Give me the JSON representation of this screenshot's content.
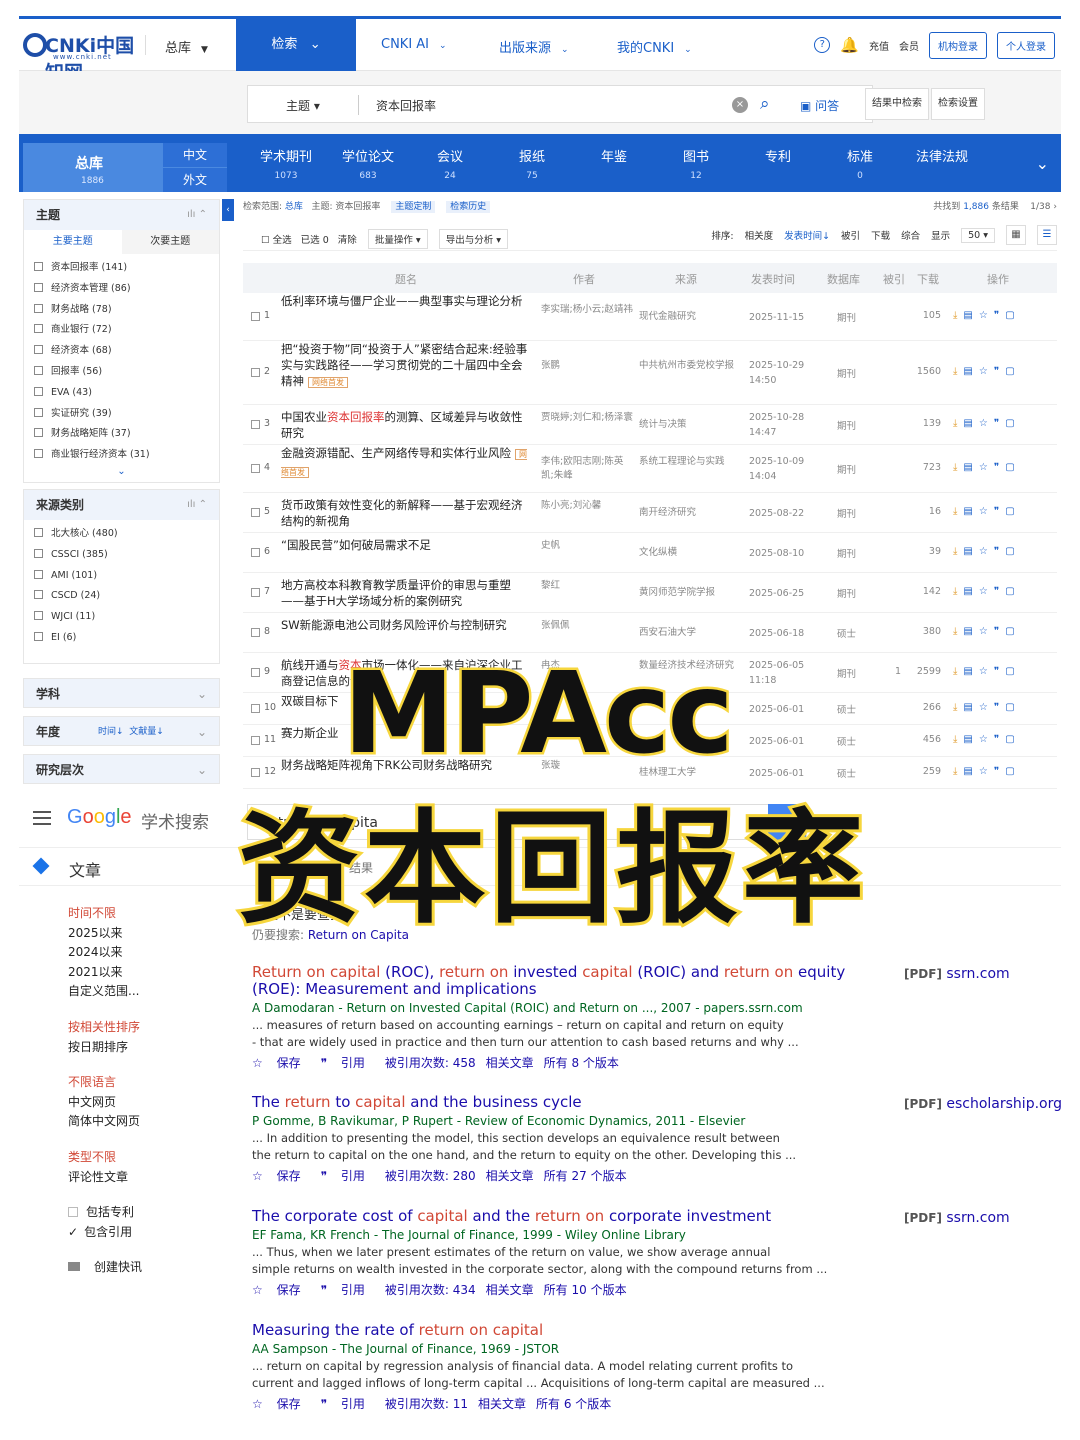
{
  "cnki": {
    "logo_text": "CNKi中国知网",
    "logo_url": "www.cnki.net",
    "nav": {
      "all": "总库",
      "search": "检索",
      "ai": "CNKI AI",
      "source": "出版来源",
      "my": "我的CNKI"
    },
    "top_right": {
      "recharge": "充值",
      "member": "会员",
      "org_login": "机构登录",
      "personal_login": "个人登录"
    },
    "search": {
      "field": "主题",
      "query": "资本回报率",
      "ask": "问答",
      "in_results": "结果中检索",
      "settings": "检索设置"
    },
    "db_all": {
      "label": "总库",
      "count": "1886",
      "zh": "中文",
      "foreign": "外文"
    },
    "databases": [
      {
        "label": "学术期刊",
        "count": "1073"
      },
      {
        "label": "学位论文",
        "count": "683"
      },
      {
        "label": "会议",
        "count": "24"
      },
      {
        "label": "报纸",
        "count": "75"
      },
      {
        "label": "年鉴",
        "count": ""
      },
      {
        "label": "图书",
        "count": "12"
      },
      {
        "label": "专利",
        "count": ""
      },
      {
        "label": "标准",
        "count": "0"
      },
      {
        "label": "法律法规",
        "count": ""
      }
    ],
    "sidebar": {
      "topic": {
        "title": "主题",
        "tab_main": "主要主题",
        "tab_sub": "次要主题",
        "items": [
          "资本回报率 (141)",
          "经济资本管理 (86)",
          "财务战略 (78)",
          "商业银行 (72)",
          "经济资本 (68)",
          "回报率 (56)",
          "EVA (43)",
          "实证研究 (39)",
          "财务战略矩阵 (37)",
          "商业银行经济资本 (31)"
        ]
      },
      "source": {
        "title": "来源类别",
        "items": [
          "北大核心 (480)",
          "CSSCI (385)",
          "AMI (101)",
          "CSCD (24)",
          "WJCI (11)",
          "EI (6)"
        ]
      },
      "subject": "学科",
      "year": {
        "title": "年度",
        "sort_time": "时间↓",
        "sort_count": "文献量↓"
      },
      "level": "研究层次"
    },
    "crumb": {
      "scope": "检索范围:",
      "scope_val": "总库",
      "topic": "主题: 资本回报率",
      "custom": "主题定制",
      "history": "检索历史",
      "found": "共找到",
      "found_num": "1,886",
      "found_suffix": "条结果",
      "page": "1/38"
    },
    "toolbar": {
      "select_all": "全选",
      "selected": "已选",
      "selected_num": "0",
      "clear": "清除",
      "batch": "批量操作",
      "export": "导出与分析",
      "sort_label": "排序:",
      "relevance": "相关度",
      "pub_time": "发表时间↓",
      "cited": "被引",
      "download": "下载",
      "overall": "综合",
      "show": "显示",
      "per_page": "50"
    },
    "headers": {
      "title": "题名",
      "author": "作者",
      "source": "来源",
      "date": "发表时间",
      "db": "数据库",
      "cited": "被引",
      "download": "下载",
      "ops": "操作"
    },
    "rows": [
      {
        "no": "1",
        "pre": "低利率环境与僵尸企业——典型事实与理论分析",
        "hl": "",
        "post": "",
        "badge": "",
        "author": "李实瑞;杨小云;赵靖祎",
        "source": "现代金融研究",
        "date": "2025-11-15",
        "db": "期刊",
        "cited": "",
        "dl": "105"
      },
      {
        "no": "2",
        "pre": "把“投资于物”同“投资于人”紧密结合起来:经验事实与实践路径——学习贯彻党的二十届四中全会精神",
        "hl": "",
        "post": "",
        "badge": "网络首发",
        "author": "张鹏",
        "source": "中共杭州市委党校学报",
        "date": "2025-10-29 14:50",
        "db": "期刊",
        "cited": "",
        "dl": "1560"
      },
      {
        "no": "3",
        "pre": "中国农业",
        "hl": "资本回报率",
        "post": "的测算、区域差异与收敛性研究",
        "badge": "",
        "author": "贾晓婷;刘仁和;杨泽寰",
        "source": "统计与决策",
        "date": "2025-10-28 14:47",
        "db": "期刊",
        "cited": "",
        "dl": "139"
      },
      {
        "no": "4",
        "pre": "金融资源错配、生产网络传导和实体行业风险",
        "hl": "",
        "post": "",
        "badge": "网络首发",
        "author": "李伟;欧阳志刚;陈英凯;朱峰",
        "source": "系统工程理论与实践",
        "date": "2025-10-09 14:04",
        "db": "期刊",
        "cited": "",
        "dl": "723"
      },
      {
        "no": "5",
        "pre": "货币政策有效性变化的新解释——基于宏观经济结构的新视角",
        "hl": "",
        "post": "",
        "badge": "",
        "author": "陈小亮;刘沁馨",
        "source": "南开经济研究",
        "date": "2025-08-22",
        "db": "期刊",
        "cited": "",
        "dl": "16"
      },
      {
        "no": "6",
        "pre": "“国股民营”如何破局需求不足",
        "hl": "",
        "post": "",
        "badge": "",
        "author": "史帆",
        "source": "文化纵横",
        "date": "2025-08-10",
        "db": "期刊",
        "cited": "",
        "dl": "39"
      },
      {
        "no": "7",
        "pre": "地方高校本科教育教学质量评价的审思与重塑——基于H大学场域分析的案例研究",
        "hl": "",
        "post": "",
        "badge": "",
        "author": "黎红",
        "source": "黄冈师范学院学报",
        "date": "2025-06-25",
        "db": "期刊",
        "cited": "",
        "dl": "142"
      },
      {
        "no": "8",
        "pre": "SW新能源电池公司财务风险评价与控制研究",
        "hl": "",
        "post": "",
        "badge": "",
        "author": "张佩佩",
        "source": "西安石油大学",
        "date": "2025-06-18",
        "db": "硕士",
        "cited": "",
        "dl": "380"
      },
      {
        "no": "9",
        "pre": "航线开通与",
        "hl": "资本",
        "post": "市场一体化——来自沪深企业工商登记信息的证据",
        "badge": "",
        "author": "冉杰",
        "source": "数量经济技术经济研究",
        "date": "2025-06-05 11:18",
        "db": "期刊",
        "cited": "1",
        "dl": "2599"
      },
      {
        "no": "10",
        "pre": "双碳目标下",
        "hl": "",
        "post": "",
        "badge": "",
        "author": "",
        "source": "",
        "date": "2025-06-01",
        "db": "硕士",
        "cited": "",
        "dl": "266"
      },
      {
        "no": "11",
        "pre": "赛力斯企业",
        "hl": "",
        "post": "",
        "badge": "",
        "author": "",
        "source": "",
        "date": "2025-06-01",
        "db": "硕士",
        "cited": "",
        "dl": "456"
      },
      {
        "no": "12",
        "pre": "财务战略矩阵视角下RK公司财务战略研究",
        "hl": "",
        "post": "",
        "badge": "",
        "author": "张璇",
        "source": "桂林理工大学",
        "date": "2025-06-01",
        "db": "硕士",
        "cited": "",
        "dl": "259"
      }
    ]
  },
  "google": {
    "logo": "Google",
    "product": "学术搜索",
    "query": "Return on Capita",
    "section": "文章",
    "found_text": "结果",
    "didyou_prefix": "您是不是要查找",
    "searched_label": "仍要搜索:",
    "searched_query": "Return on Capita",
    "side": {
      "time": [
        "时间不限",
        "2025以来",
        "2024以来",
        "2021以来",
        "自定义范围..."
      ],
      "sort": [
        "按相关性排序",
        "按日期排序"
      ],
      "lang": [
        "不限语言",
        "中文网页",
        "简体中文网页"
      ],
      "type": [
        "类型不限",
        "评论性文章"
      ],
      "include_patents": "包括专利",
      "include_citations": "包含引用",
      "alert": "创建快讯"
    },
    "actions": {
      "save": "保存",
      "cite": "引用",
      "related": "相关文章"
    },
    "results": [
      {
        "title_parts": [
          [
            "Return on capital",
            true
          ],
          [
            " (ROC), ",
            false
          ],
          [
            "return on",
            true
          ],
          [
            " invested ",
            false
          ],
          [
            "capital",
            true
          ],
          [
            " (ROIC) and ",
            false
          ],
          [
            "return on",
            true
          ],
          [
            " equity (ROE): Measurement and implications",
            false
          ]
        ],
        "meta": "A Damodaran - Return on Invested Capital (ROIC) and Return on ..., 2007 - papers.ssrn.com",
        "snip1": "... measures of return based on accounting earnings – return on capital and return on equity",
        "snip2": "- that are widely used in practice and then turn our attention to cash based returns and why ...",
        "cited": "被引用次数: 458",
        "versions": "所有 8 个版本",
        "pdf_tag": "[PDF]",
        "pdf_host": "ssrn.com"
      },
      {
        "title_parts": [
          [
            "The ",
            false
          ],
          [
            "return",
            true
          ],
          [
            " to ",
            false
          ],
          [
            "capital",
            true
          ],
          [
            " and the business cycle",
            false
          ]
        ],
        "meta": "P Gomme, B Ravikumar, P Rupert - Review of Economic Dynamics, 2011 - Elsevier",
        "snip1": "... In addition to presenting the model, this section develops an equivalence result between",
        "snip2": "the return to capital on the one hand, and the return to equity on the other. Developing this ...",
        "cited": "被引用次数: 280",
        "versions": "所有 27 个版本",
        "pdf_tag": "[PDF]",
        "pdf_host": "escholarship.org"
      },
      {
        "title_parts": [
          [
            "The corporate cost of ",
            false
          ],
          [
            "capital",
            true
          ],
          [
            " and the ",
            false
          ],
          [
            "return on",
            true
          ],
          [
            " corporate investment",
            false
          ]
        ],
        "meta": "EF Fama, KR French - The Journal of Finance, 1999 - Wiley Online Library",
        "snip1": "... Thus, when we later present estimates of the return on value, we show average annual",
        "snip2": "simple returns on wealth invested in the corporate sector, along with the compound returns from ...",
        "cited": "被引用次数: 434",
        "versions": "所有 10 个版本",
        "pdf_tag": "[PDF]",
        "pdf_host": "ssrn.com"
      },
      {
        "title_parts": [
          [
            "Measuring the rate of ",
            false
          ],
          [
            "return on capital",
            true
          ]
        ],
        "meta": "AA Sampson - The Journal of Finance, 1969 - JSTOR",
        "snip1": "... return on capital by regression analysis of financial data. A model relating current profits to",
        "snip2": "current and lagged inflows of long-term capital ... Acquisitions of long-term capital are measured ...",
        "cited": "被引用次数: 11",
        "versions": "所有 6 个版本",
        "pdf_tag": "",
        "pdf_host": ""
      }
    ]
  },
  "overlay": {
    "line1": "MPAcc",
    "line2": "资本回报率",
    "fill_color": "#111111",
    "stroke_color": "#f6d63d"
  },
  "colors": {
    "cnki_blue": "#1a5fc9",
    "google_link": "#1a0dab",
    "highlight_red": "#d14836"
  }
}
